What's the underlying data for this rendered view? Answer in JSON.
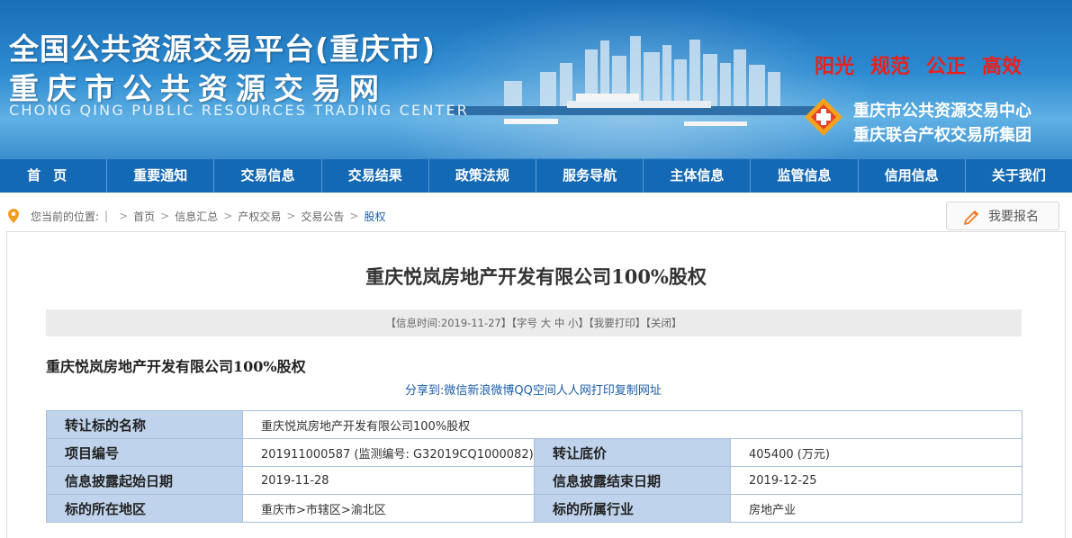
{
  "header": {
    "title_main": "全国公共资源交易平台(重庆市)",
    "title_sub": "重庆市公共资源交易网",
    "title_en": "CHONG QING PUBLIC RESOURCES TRADING CENTER",
    "slogans": [
      "阳光",
      "规范",
      "公正",
      "高效"
    ],
    "org_line1": "重庆市公共资源交易中心",
    "org_line2": "重庆联合产权交易所集团",
    "slogan_color": "#e8201c"
  },
  "nav": {
    "items": [
      "首页",
      "重要通知",
      "交易信息",
      "交易结果",
      "政策法规",
      "服务导航",
      "主体信息",
      "监管信息",
      "信用信息",
      "关于我们"
    ],
    "bg_color": "#1469b4"
  },
  "breadcrumb": {
    "prefix": "您当前的位置:",
    "items": [
      "首页",
      "信息汇总",
      "产权交易",
      "交易公告",
      "股权"
    ]
  },
  "signup_button": {
    "label": "我要报名",
    "icon": "pencil-icon"
  },
  "article": {
    "title": "重庆悦岚房地产开发有限公司100%股权",
    "infobar": {
      "time_prefix": "【信息时间:",
      "date": "2019-11-27",
      "font_label": "】【字号",
      "size_large": "大",
      "size_medium": "中",
      "size_small": "小",
      "print": "】【我要打印",
      "close": "】【关闭】"
    },
    "subtitle": "重庆悦岚房地产开发有限公司100%股权",
    "share": {
      "label": "分享到:",
      "targets": [
        "微信",
        "新浪微博",
        "QQ空间",
        "人人网",
        "打印",
        "复制网址"
      ]
    }
  },
  "info_table": {
    "rows": [
      {
        "label": "转让标的名称",
        "value": "重庆悦岚房地产开发有限公司100%股权"
      },
      {
        "label": "项目编号",
        "value": "201911000587 (监测编号: G32019CQ1000082)",
        "label2": "转让底价",
        "value2": "405400 (万元)"
      },
      {
        "label": "信息披露起始日期",
        "value": "2019-11-28",
        "label2": "信息披露结束日期",
        "value2": "2019-12-25"
      },
      {
        "label": "标的所在地区",
        "value": "重庆市>市辖区>渝北区",
        "label2": "标的所属行业",
        "value2": "房地产业"
      }
    ],
    "label_bg": "#bfd3ec"
  }
}
